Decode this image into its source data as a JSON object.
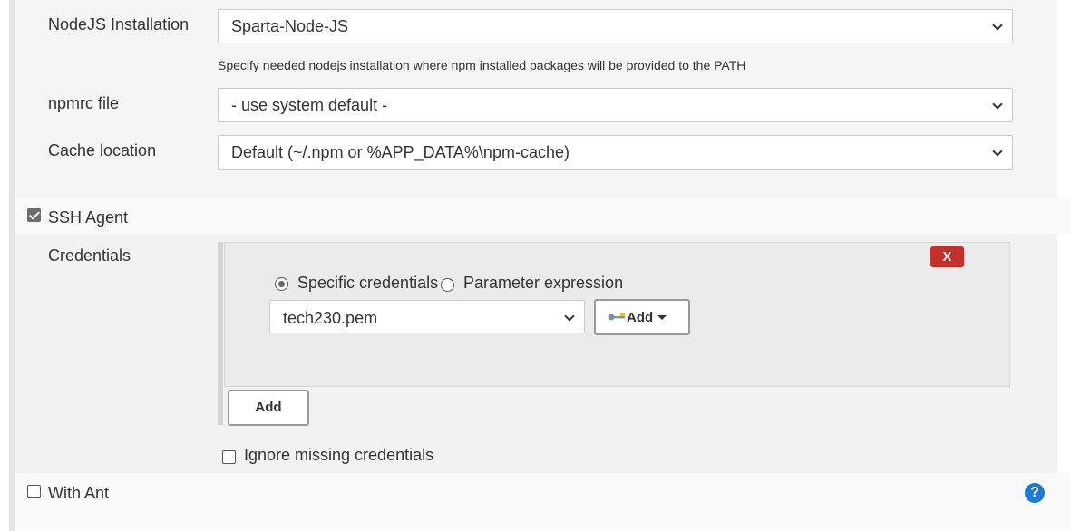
{
  "nodejs": {
    "label": "NodeJS Installation",
    "selected": "Sparta-Node-JS",
    "help": "Specify needed nodejs installation where npm installed packages will be provided to the PATH"
  },
  "npmrc": {
    "label": "npmrc file",
    "selected": "- use system default -"
  },
  "cache": {
    "label": "Cache location",
    "selected": "Default (~/.npm or %APP_DATA%\\npm-cache)"
  },
  "ssh_agent": {
    "label": "SSH Agent",
    "checked": true
  },
  "credentials": {
    "label": "Credentials",
    "delete_label": "X",
    "radio_specific": "Specific credentials",
    "radio_parameter": "Parameter expression",
    "selected": "tech230.pem",
    "add_dropdown_label": "Add",
    "add_button_label": "Add",
    "ignore_missing_label": "Ignore missing credentials"
  },
  "with_ant": {
    "label": "With Ant",
    "checked": false
  },
  "help_icon": "?",
  "colors": {
    "delete": "#c4312b",
    "help": "#1a7ad4"
  }
}
